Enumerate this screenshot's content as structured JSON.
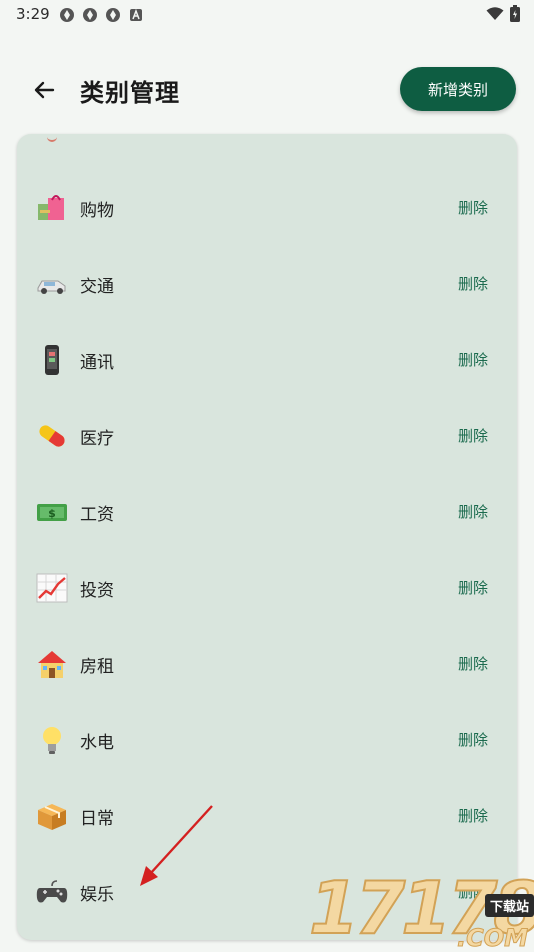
{
  "status_bar": {
    "time": "3:29"
  },
  "app_bar": {
    "title": "类别管理",
    "add_button": "新增类别"
  },
  "categories": [
    {
      "name": "购物",
      "icon": "shopping-bags-icon",
      "delete": "删除"
    },
    {
      "name": "交通",
      "icon": "car-icon",
      "delete": "删除"
    },
    {
      "name": "通讯",
      "icon": "mobile-phone-icon",
      "delete": "删除"
    },
    {
      "name": "医疗",
      "icon": "pill-icon",
      "delete": "删除"
    },
    {
      "name": "工资",
      "icon": "money-icon",
      "delete": "删除"
    },
    {
      "name": "投资",
      "icon": "chart-increasing-icon",
      "delete": "删除"
    },
    {
      "name": "房租",
      "icon": "house-icon",
      "delete": "删除"
    },
    {
      "name": "水电",
      "icon": "light-bulb-icon",
      "delete": "删除"
    },
    {
      "name": "日常",
      "icon": "package-icon",
      "delete": "删除"
    },
    {
      "name": "娱乐",
      "icon": "game-controller-icon",
      "delete": "删除"
    }
  ],
  "watermark": {
    "digits": "17178",
    "badge": "下载站",
    "suffix": ".COM"
  },
  "colors": {
    "accent": "#0e5d42",
    "card": "#d9e5dd",
    "delete_text": "#1b6b4e",
    "background": "#f3f6f3"
  }
}
